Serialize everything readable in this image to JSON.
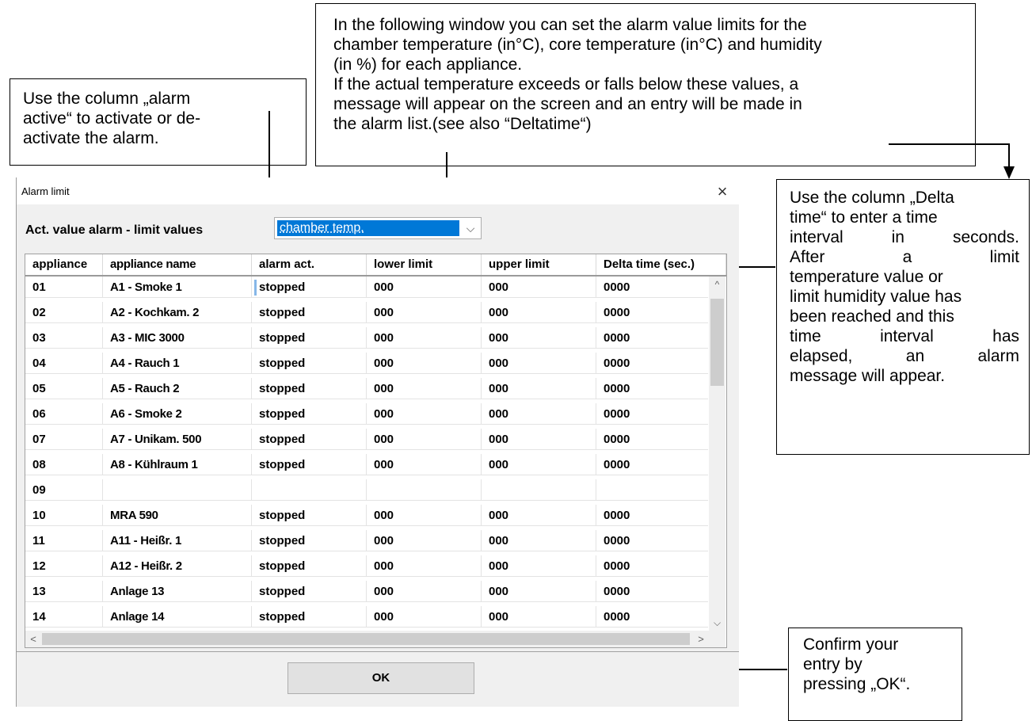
{
  "callouts": {
    "left": [
      "Use the column „alarm",
      "active“ to activate or de-",
      "activate the alarm."
    ],
    "top": [
      "In the following window you can set the alarm value limits for the",
      "chamber temperature (in°C), core temperature (in°C) and humidity",
      "(in %) for each appliance.",
      "If the actual temperature exceeds or falls below these values, a",
      "message will appear on the screen and an entry will be made in",
      "the alarm list.(see also “Deltatime“)"
    ],
    "right": [
      [
        "Use the column „Delta"
      ],
      [
        "time“ to enter a time"
      ],
      [
        "interval",
        "in",
        "seconds."
      ],
      [
        "After",
        "a",
        "limit"
      ],
      [
        "temperature value or"
      ],
      [
        "limit humidity value has"
      ],
      [
        "been reached and this"
      ],
      [
        "time",
        "interval",
        "has"
      ],
      [
        "elapsed,",
        "an",
        "alarm"
      ],
      [
        "message will appear."
      ]
    ],
    "bottom": [
      "Confirm your",
      "entry by",
      "pressing „OK“."
    ]
  },
  "dialog": {
    "title": "Alarm limit",
    "close_glyph": "×",
    "act_label": "Act. value alarm - limit values",
    "combo_value": "chamber temp.",
    "combo_arrow": "⌵",
    "columns": [
      "appliance",
      "appliance name",
      "alarm act.",
      "lower limit",
      "upper limit",
      "Delta time (sec.)"
    ],
    "rows": [
      [
        "01",
        "A1 - Smoke 1",
        "stopped",
        "000",
        "000",
        "0000"
      ],
      [
        "02",
        "A2 - Kochkam. 2",
        "stopped",
        "000",
        "000",
        "0000"
      ],
      [
        "03",
        "A3 - MIC 3000",
        "stopped",
        "000",
        "000",
        "0000"
      ],
      [
        "04",
        "A4 - Rauch 1",
        "stopped",
        "000",
        "000",
        "0000"
      ],
      [
        "05",
        "A5 - Rauch 2",
        "stopped",
        "000",
        "000",
        "0000"
      ],
      [
        "06",
        "A6 - Smoke 2",
        "stopped",
        "000",
        "000",
        "0000"
      ],
      [
        "07",
        "A7 - Unikam. 500",
        "stopped",
        "000",
        "000",
        "0000"
      ],
      [
        "08",
        "A8 - Kühlraum 1",
        "stopped",
        "000",
        "000",
        "0000"
      ],
      [
        "09",
        "",
        "",
        "",
        "",
        ""
      ],
      [
        "10",
        "MRA 590",
        "stopped",
        "000",
        "000",
        "0000"
      ],
      [
        "11",
        "A11 - Heißr. 1",
        "stopped",
        "000",
        "000",
        "0000"
      ],
      [
        "12",
        "A12 - Heißr. 2",
        "stopped",
        "000",
        "000",
        "0000"
      ],
      [
        "13",
        "Anlage 13",
        "stopped",
        "000",
        "000",
        "0000"
      ],
      [
        "14",
        "Anlage 14",
        "stopped",
        "000",
        "000",
        "0000"
      ]
    ],
    "scroll": {
      "up": "^",
      "down": "⌵",
      "left": "<",
      "right": ">"
    },
    "ok_label": "OK"
  }
}
